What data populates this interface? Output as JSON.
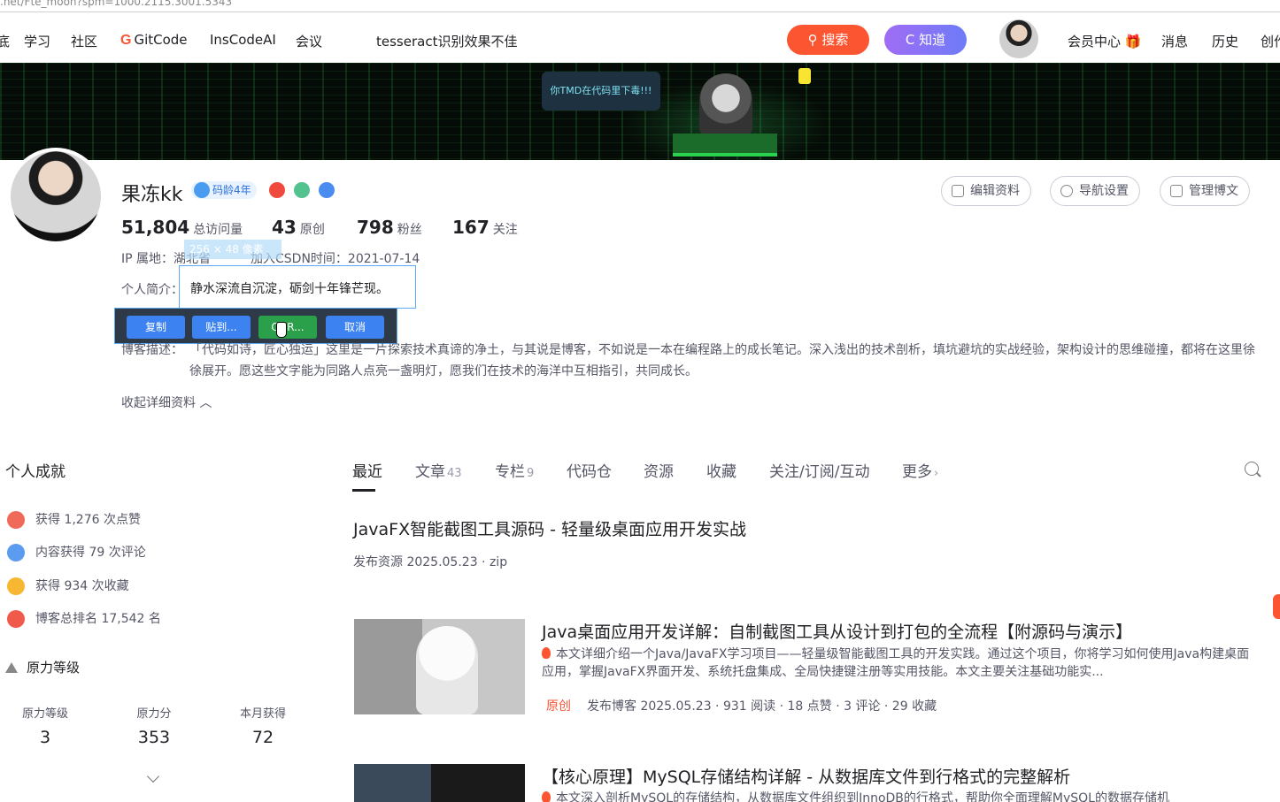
{
  "url": ".net/Fte_moon?spm=1000.2115.3001.5343",
  "nav": {
    "items": [
      "底",
      "学习",
      "社区",
      "GitCode",
      "InsCodeAI",
      "会议"
    ],
    "search_query": "tesseract识别效果不佳",
    "search_btn": "搜索",
    "zhidao_btn": "知道",
    "right_items": [
      "会员中心",
      "消息",
      "历史",
      "创作"
    ]
  },
  "banner": {
    "bubble": "你TMD在代码里下毒!!!"
  },
  "profile": {
    "name": "果冻kk",
    "badge_age": "码龄4年",
    "stats": [
      {
        "num": "51,804",
        "label": "总访问量"
      },
      {
        "num": "43",
        "label": "原创"
      },
      {
        "num": "798",
        "label": "粉丝"
      },
      {
        "num": "167",
        "label": "关注"
      }
    ],
    "buttons": [
      "编辑资料",
      "导航设置",
      "管理博文"
    ],
    "ip_label": "IP 属地：",
    "ip_value": "湖北省",
    "join_label": "加入CSDN时间：",
    "join_value": "2021-07-14",
    "intro_label": "个人简介：",
    "intro_text": "静水深流自沉淀，砺剑十年锋芒现。",
    "size_tag": "256 × 48 像素",
    "desc_label": "博客描述：",
    "desc_text": "「代码如诗，匠心独运」这里是一片探索技术真谛的净土，与其说是博客，不如说是一本在编程路上的成长笔记。深入浅出的技术剖析，填坑避坑的实战经验，架构设计的思维碰撞，都将在这里徐徐展开。愿这些文字能为同路人点亮一盏明灯，愿我们在技术的海洋中互相指引，共同成长。",
    "collapse": "收起详细资料"
  },
  "ocr_toolbar": [
    "复制",
    "贴到...",
    "OCR...",
    "取消"
  ],
  "colors": {
    "accent": "#fc5531",
    "blue_btn": "#3c82f0",
    "green_btn": "#2aa04a"
  },
  "sidebar": {
    "title": "个人成就",
    "achievements": [
      {
        "text": "获得 1,276 次点赞",
        "icon": "like-icon"
      },
      {
        "text": "内容获得 79 次评论",
        "icon": "comment-icon"
      },
      {
        "text": "获得 934 次收藏",
        "icon": "star-icon"
      },
      {
        "text": "博客总排名 17,542 名",
        "icon": "rank-icon"
      }
    ],
    "force_title": "原力等级",
    "force": [
      {
        "label": "原力等级",
        "value": "3"
      },
      {
        "label": "原力分",
        "value": "353"
      },
      {
        "label": "本月获得",
        "value": "72"
      }
    ]
  },
  "tabs": [
    {
      "label": "最近",
      "count": ""
    },
    {
      "label": "文章",
      "count": "43"
    },
    {
      "label": "专栏",
      "count": "9"
    },
    {
      "label": "代码仓",
      "count": ""
    },
    {
      "label": "资源",
      "count": ""
    },
    {
      "label": "收藏",
      "count": ""
    },
    {
      "label": "关注/订阅/互动",
      "count": ""
    },
    {
      "label": "更多",
      "count": "›"
    }
  ],
  "articles": [
    {
      "title": "JavaFX智能截图工具源码 - 轻量级桌面应用开发实战",
      "meta": "发布资源 2025.05.23 ·  zip"
    },
    {
      "title": "Java桌面应用开发详解：自制截图工具从设计到打包的全流程【附源码与演示】",
      "desc": "本文详细介绍一个Java/JavaFX学习项目——轻量级智能截图工具的开发实践。通过这个项目，你将学习如何使用Java构建桌面应用，掌握JavaFX界面开发、系统托盘集成、全局快捷键注册等实用技能。本文主要关注基础功能实...",
      "tag": "原创",
      "meta": "发布博客 2025.05.23 ·  931 阅读 ·  18 点赞 ·  3 评论 ·  29 收藏"
    },
    {
      "title": "【核心原理】MySQL存储结构详解 - 从数据库文件到行格式的完整解析",
      "desc": "本文深入剖析MySQL的存储结构，从数据库文件组织到InnoDB的行格式，帮助你全面理解MySQL的数据存储机"
    }
  ]
}
